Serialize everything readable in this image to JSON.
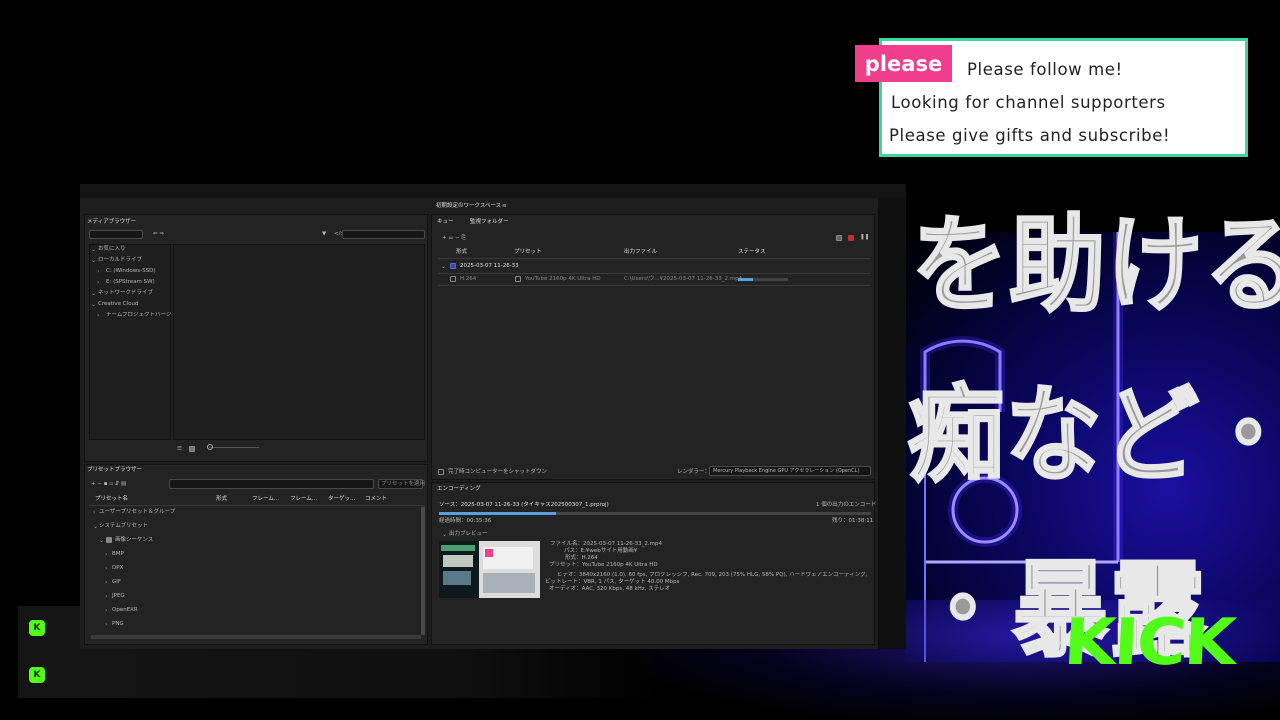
{
  "overlay": {
    "banner_tag": "please",
    "banner_lines": [
      "Please follow me!",
      "Looking for channel supporters",
      "Please give gifts and subscribe!"
    ],
    "jp_lines": [
      "を助ける",
      "痴など・・・",
      "・暴露"
    ],
    "platform_logo_text": "KICK",
    "chat_badge": "K"
  },
  "app": {
    "workspace_title": "初期設定のワークスペース",
    "media_browser": {
      "title": "メディアブラウザー",
      "tree": [
        {
          "label": "お気に入り",
          "level": 0
        },
        {
          "label": "ローカルドライブ",
          "level": 0
        },
        {
          "label": "C: (Windows-SSD)",
          "level": 1
        },
        {
          "label": "E: (SPStream SW)",
          "level": 1
        },
        {
          "label": "ネットワークドライブ",
          "level": 0
        },
        {
          "label": "Creative Cloud",
          "level": 0
        },
        {
          "label": "チームプロジェクトバージョ",
          "level": 1
        }
      ]
    },
    "preset_browser": {
      "title": "プリセットブラウザー",
      "apply_button": "プリセットを適用",
      "columns": [
        "プリセット名",
        "形式",
        "フレーム...",
        "フレーム...",
        "ターゲッ...",
        "コメント"
      ],
      "rows": [
        {
          "label": "ユーザープリセット＆グループ",
          "level": 0
        },
        {
          "label": "システムプリセット",
          "level": 0
        },
        {
          "label": "画像シーケンス",
          "level": 1
        },
        {
          "label": "BMP",
          "level": 2
        },
        {
          "label": "DPX",
          "level": 2
        },
        {
          "label": "GIF",
          "level": 2
        },
        {
          "label": "JPEG",
          "level": 2
        },
        {
          "label": "OpenEXR",
          "level": 2
        },
        {
          "label": "PNG",
          "level": 2
        }
      ]
    },
    "queue": {
      "tabs": [
        "キュー",
        "監視フォルダー"
      ],
      "columns": [
        "形式",
        "プリセット",
        "出力ファイル",
        "ステータス"
      ],
      "group_label": "2025-03-07 11-26-33",
      "item": {
        "format": "H.264",
        "preset": "YouTube 2160p 4K Ultra HD",
        "output": "C:\\Users\\ウ...¥2025-03-07 11-26-33_2.mp4",
        "progress": 0.3
      },
      "shutdown_label": "完了時コンピューターをシャットダウン",
      "renderer_label": "レンダラー：",
      "renderer_value": "Mercury Playback Engine GPU アクセラレーション (OpenCL)"
    },
    "encoding": {
      "title": "エンコーディング",
      "source": "ソース：2025-03-07 11-26-33 (タイキャス202500307_1.prproj)",
      "count": "1 個の出力のエンコード",
      "elapsed": "経過時間：00:35:36",
      "remaining": "残り：01:38:11",
      "progress": 0.27,
      "preview_label": "出力プレビュー",
      "details": [
        "ファイル名：2025-03-07 11-26-33_2.mp4",
        "パス：E:¥webサイト用動画¥",
        "形式：H.264",
        "プリセット：YouTube 2160p 4K Ultra HD",
        "ビデオ：3840x2160 (1.0), 60 fps, プログレッシブ, Rec. 709, 203 (75% HLG, 58% PQ), ハードウェアエンコーディング, NV &...",
        "ビットレート：VBR, 1 パス, ターゲット 40.00 Mbps",
        "オーディオ：AAC, 320 Kbps, 48 kHz, ステレオ"
      ]
    }
  }
}
